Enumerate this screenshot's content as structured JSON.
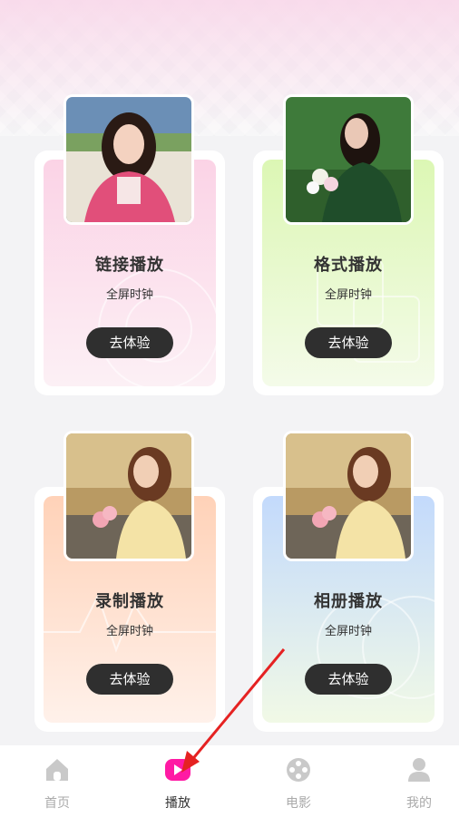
{
  "cards": [
    {
      "title": "链接播放",
      "subtitle": "全屏时钟",
      "button": "去体验",
      "photo_icon": "portrait-photo-pink-sweater"
    },
    {
      "title": "格式播放",
      "subtitle": "全屏时钟",
      "button": "去体验",
      "photo_icon": "portrait-photo-green-field"
    },
    {
      "title": "录制播放",
      "subtitle": "全屏时钟",
      "button": "去体验",
      "photo_icon": "portrait-photo-tulips-beach"
    },
    {
      "title": "相册播放",
      "subtitle": "全屏时钟",
      "button": "去体验",
      "photo_icon": "portrait-photo-tulips-beach"
    }
  ],
  "tabbar": {
    "items": [
      {
        "label": "首页",
        "icon": "home-icon",
        "active": false
      },
      {
        "label": "播放",
        "icon": "play-icon",
        "active": true
      },
      {
        "label": "电影",
        "icon": "film-reel-icon",
        "active": false
      },
      {
        "label": "我的",
        "icon": "user-icon",
        "active": false
      }
    ]
  },
  "colors": {
    "accent": "#ff1aa4",
    "card_pink": "#fbd3e6",
    "card_green": "#dcf7b4",
    "card_orange": "#ffd2b8",
    "card_blue": "#c3dafc",
    "button_bg": "#2f2f2f",
    "arrow": "#e52222"
  }
}
